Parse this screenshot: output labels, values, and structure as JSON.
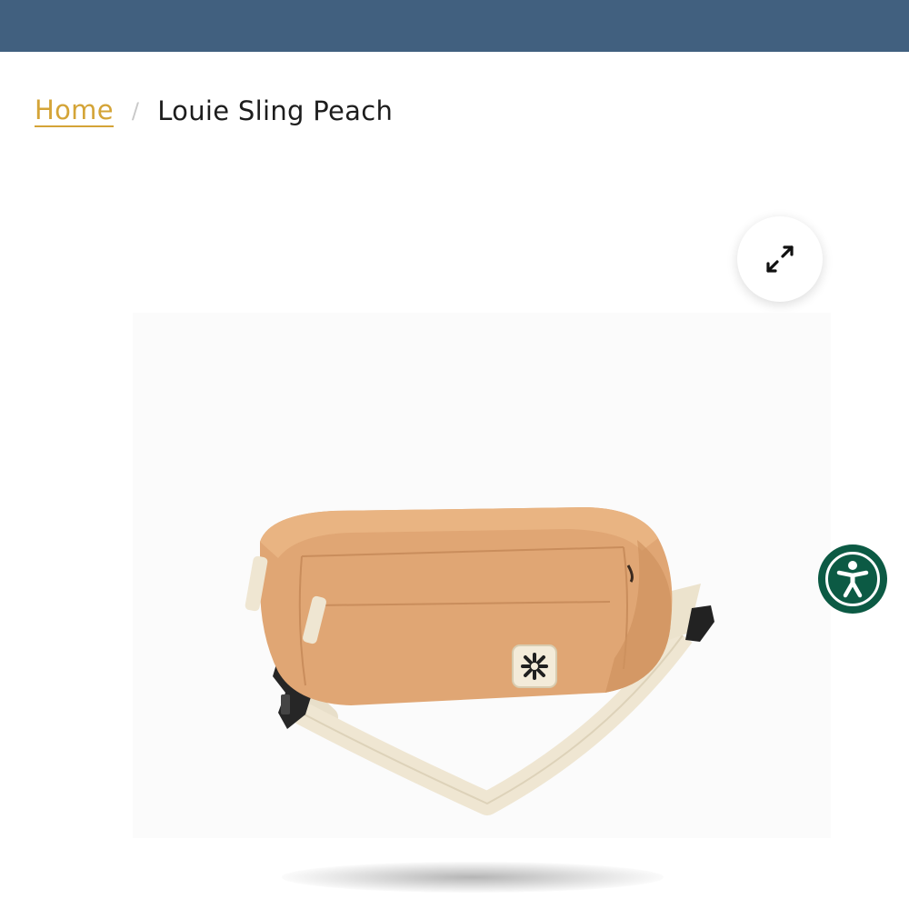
{
  "header": {
    "bar_color": "#41607f"
  },
  "breadcrumb": {
    "home_label": "Home",
    "separator": "/",
    "current_label": "Louie Sling Peach",
    "link_color": "#d4a437"
  },
  "gallery": {
    "expand_icon": "expand-arrows-icon",
    "product_image_alt": "Louie Sling Peach",
    "bag_color": "#e0a674",
    "strap_color": "#efe6d2"
  },
  "accessibility": {
    "icon": "accessibility-person-icon",
    "color": "#0c5a44"
  }
}
